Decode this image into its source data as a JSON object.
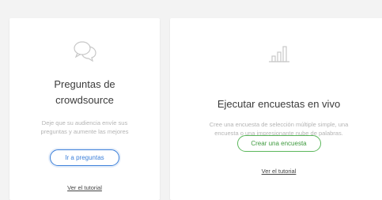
{
  "colors": {
    "page_bg": "#f3f3f3",
    "card_bg": "#ffffff",
    "primary_blue": "#3b7fd9",
    "primary_green": "#5cb85c",
    "muted_text": "#b4b4b4"
  },
  "cards": [
    {
      "icon": "chat-bubbles-icon",
      "title_line1": "Preguntas de",
      "title_line2": "crowdsource",
      "description_line1": "Deje que su audiencia envíe sus",
      "description_line2": "preguntas y aumente las mejores",
      "button_label": "Ir a preguntas",
      "link_label": "Ver el tutorial"
    },
    {
      "icon": "bar-chart-icon",
      "title": "Ejecutar encuestas en vivo",
      "description_line1": "Cree una encuesta de selección múltiple simple, una",
      "description_line2": "encuesta o una impresionante nube de palabras.",
      "button_label": "Crear una encuesta",
      "link_label": "Ver el tutorial"
    }
  ]
}
